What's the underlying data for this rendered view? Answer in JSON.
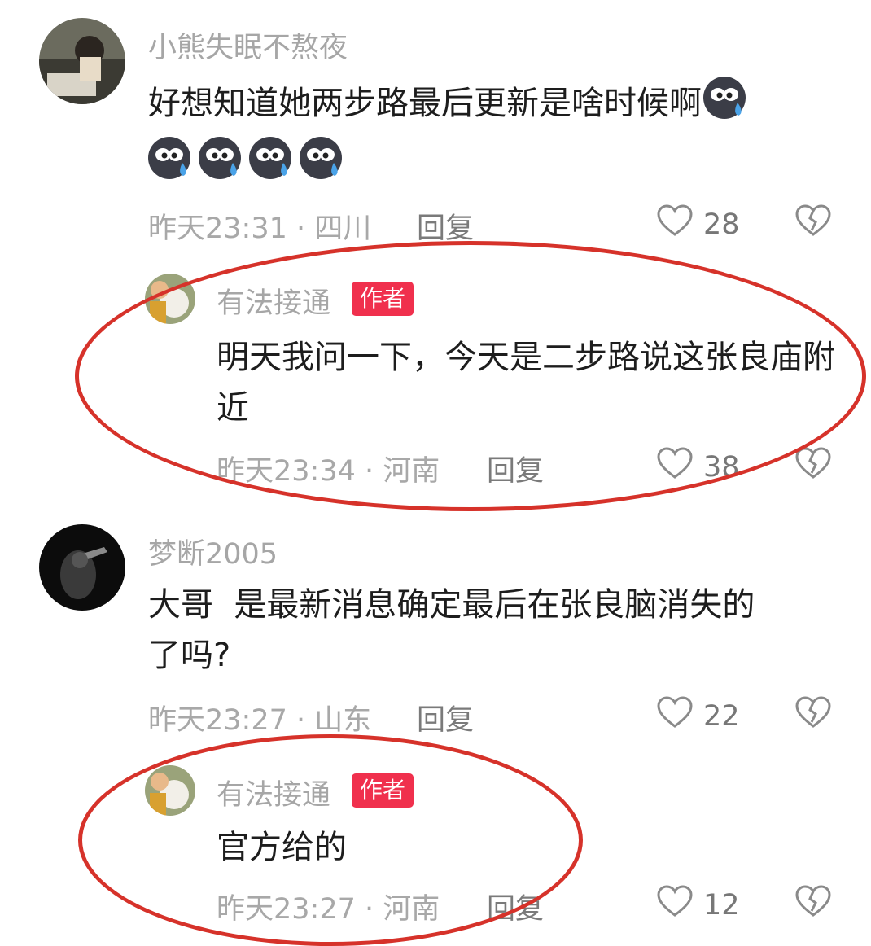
{
  "comments": [
    {
      "username": "小熊失眠不熬夜",
      "text": "好想知道她两步路最后更新是啥时候啊",
      "time_location": "昨天23:31 · 四川",
      "reply_label": "回复",
      "likes": "28",
      "emoji_icon": "crying-emoji-icon",
      "reply": {
        "username": "有法接通",
        "badge": "作者",
        "text": "明天我问一下，今天是二步路说这张良庙附近",
        "time_location": "昨天23:34 · 河南",
        "reply_label": "回复",
        "likes": "38"
      }
    },
    {
      "username": "梦断2005",
      "text_line1": "大哥  是最新消息确定最后在张良脑消失的",
      "text_line2": "了吗?",
      "time_location": "昨天23:27 · 山东",
      "reply_label": "回复",
      "likes": "22",
      "reply": {
        "username": "有法接通",
        "badge": "作者",
        "text": "官方给的",
        "time_location": "昨天23:27 · 河南",
        "reply_label": "回复",
        "likes": "12"
      }
    }
  ],
  "annotation_color": "#d6322a",
  "badge_color": "#f0304d"
}
